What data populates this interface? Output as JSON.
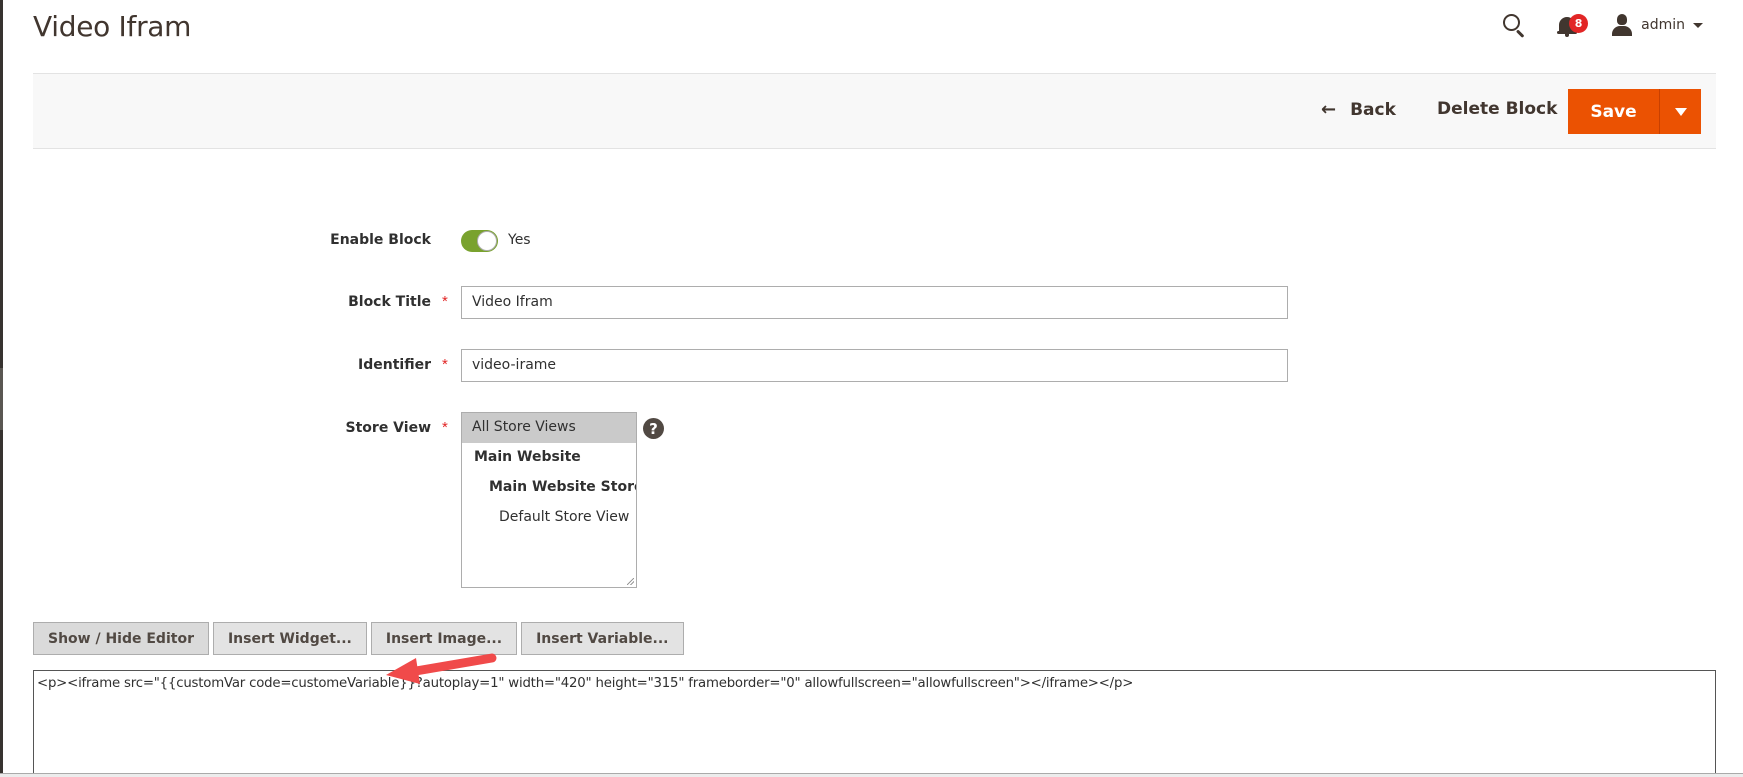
{
  "page": {
    "title": "Video Ifram"
  },
  "header": {
    "notifications_count": "8",
    "user_name": "admin"
  },
  "action_bar": {
    "back_label": "Back",
    "delete_label": "Delete Block",
    "save_label": "Save"
  },
  "form": {
    "enable_block": {
      "label": "Enable Block",
      "state_text": "Yes",
      "enabled": true
    },
    "block_title": {
      "label": "Block Title",
      "value": "Video Ifram",
      "required": true
    },
    "identifier": {
      "label": "Identifier",
      "value": "video-irame",
      "required": true
    },
    "store_view": {
      "label": "Store View",
      "required": true,
      "options": [
        {
          "label": "All Store Views",
          "selected": true
        },
        {
          "label": "Main Website",
          "selected": false
        },
        {
          "label": "Main Website Store",
          "selected": false
        },
        {
          "label": "Default Store View",
          "selected": false
        }
      ]
    },
    "required_marker": "*"
  },
  "editor": {
    "buttons": [
      {
        "label": "Show / Hide Editor"
      },
      {
        "label": "Insert Widget..."
      },
      {
        "label": "Insert Image..."
      },
      {
        "label": "Insert Variable..."
      }
    ],
    "content": "<p><iframe src=\"{{customVar code=customeVariable}}?autoplay=1\" width=\"420\" height=\"315\" frameborder=\"0\" allowfullscreen=\"allowfullscreen\"></iframe></p>"
  },
  "colors": {
    "accent": "#eb5202",
    "toggle_on": "#79a22e",
    "badge": "#e22626",
    "annotation_arrow": "#f04a4a"
  },
  "icons": {
    "search": "search-icon",
    "notifications": "bell-icon",
    "user": "user-icon",
    "back": "arrow-left-icon",
    "help": "question-icon"
  }
}
